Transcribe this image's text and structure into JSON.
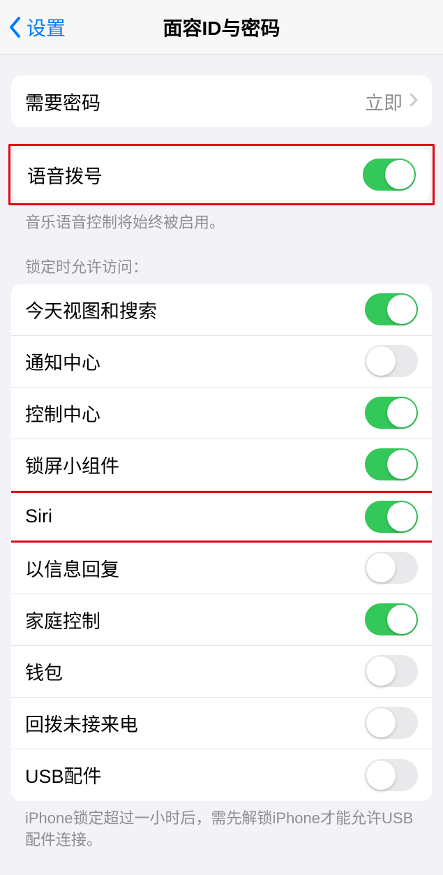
{
  "header": {
    "back_label": "设置",
    "title": "面容ID与密码"
  },
  "passcode_section": {
    "label": "需要密码",
    "value": "立即"
  },
  "voice_dial": {
    "label": "语音拨号",
    "on": true,
    "footer": "音乐语音控制将始终被启用。"
  },
  "lock_access": {
    "header": "锁定时允许访问：",
    "items": [
      {
        "label": "今天视图和搜索",
        "on": true
      },
      {
        "label": "通知中心",
        "on": false
      },
      {
        "label": "控制中心",
        "on": true
      },
      {
        "label": "锁屏小组件",
        "on": true
      },
      {
        "label": "Siri",
        "on": true
      },
      {
        "label": "以信息回复",
        "on": false
      },
      {
        "label": "家庭控制",
        "on": true
      },
      {
        "label": "钱包",
        "on": false
      },
      {
        "label": "回拨未接来电",
        "on": false
      },
      {
        "label": "USB配件",
        "on": false
      }
    ],
    "footer": "iPhone锁定超过一小时后，需先解锁iPhone才能允许USB配件连接。"
  }
}
